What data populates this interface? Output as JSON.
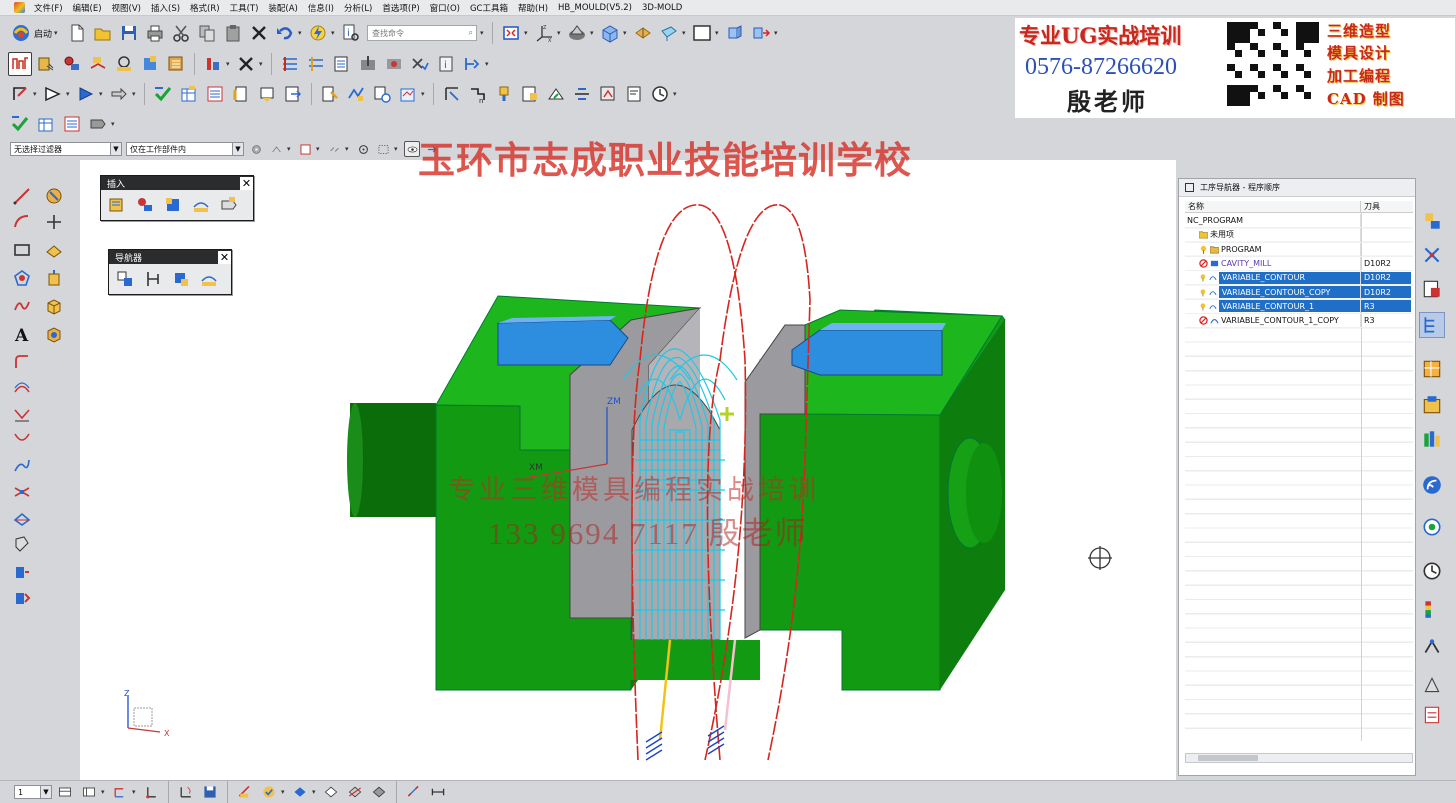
{
  "menubar": {
    "items": [
      "文件(F)",
      "编辑(E)",
      "视图(V)",
      "插入(S)",
      "格式(R)",
      "工具(T)",
      "装配(A)",
      "信息(I)",
      "分析(L)",
      "首选项(P)",
      "窗口(O)",
      "GC工具箱",
      "帮助(H)",
      "HB_MOULD(V5.2)",
      "3D-MOLD"
    ]
  },
  "toolbar": {
    "start_label": "启动",
    "search_placeholder": "查找命令"
  },
  "filterbar": {
    "type_filter": "无选择过滤器",
    "scope_filter": "仅在工作部件内"
  },
  "palettes": {
    "insert_title": "插入",
    "navigator_title": "导航器"
  },
  "op_navigator": {
    "title": "工序导航器 - 程序顺序",
    "col_name": "名称",
    "col_tool": "刀具",
    "rows": [
      {
        "name": "NC_PROGRAM",
        "tool": "",
        "indent": 0,
        "icon": "none",
        "selected": false
      },
      {
        "name": "未用项",
        "tool": "",
        "indent": 1,
        "icon": "folder",
        "selected": false
      },
      {
        "name": "PROGRAM",
        "tool": "",
        "indent": 1,
        "icon": "program",
        "selected": false
      },
      {
        "name": "CAVITY_MILL",
        "tool": "D10R2",
        "indent": 1,
        "icon": "cavity",
        "selected": false
      },
      {
        "name": "VARIABLE_CONTOUR",
        "tool": "D10R2",
        "indent": 1,
        "icon": "contour",
        "selected": true
      },
      {
        "name": "VARIABLE_CONTOUR_COPY",
        "tool": "D10R2",
        "indent": 1,
        "icon": "contour",
        "selected": true
      },
      {
        "name": "VARIABLE_CONTOUR_1",
        "tool": "R3",
        "indent": 1,
        "icon": "contour",
        "selected": true
      },
      {
        "name": "VARIABLE_CONTOUR_1_COPY",
        "tool": "R3",
        "indent": 1,
        "icon": "contour-bad",
        "selected": false
      }
    ]
  },
  "advert": {
    "title": "专业UG实战培训",
    "phone": "0576-87266620",
    "teacher": "殷老师",
    "right_lines": [
      "三维造型",
      "模具设计",
      "加工编程",
      "CAD 制图"
    ]
  },
  "school_banner": "玉环市志成职业技能培训学校",
  "watermark": {
    "line1": "专业三维模具编程实战培训",
    "line2": "133 9694 7117 殷老师"
  },
  "viewport": {
    "axis_labels": {
      "zm": "ZM",
      "xm": "XM",
      "z": "Z",
      "x": "X"
    }
  },
  "statusbar": {
    "layer_value": "1"
  },
  "colors": {
    "mold_green": "#129a12",
    "core_gray": "#9a9a9e",
    "slider_blue": "#2d8ee0",
    "toolpath_cyan": "#1fc7e6",
    "selection_blue": "#1f6fc9",
    "ad_red": "#c8281e"
  }
}
